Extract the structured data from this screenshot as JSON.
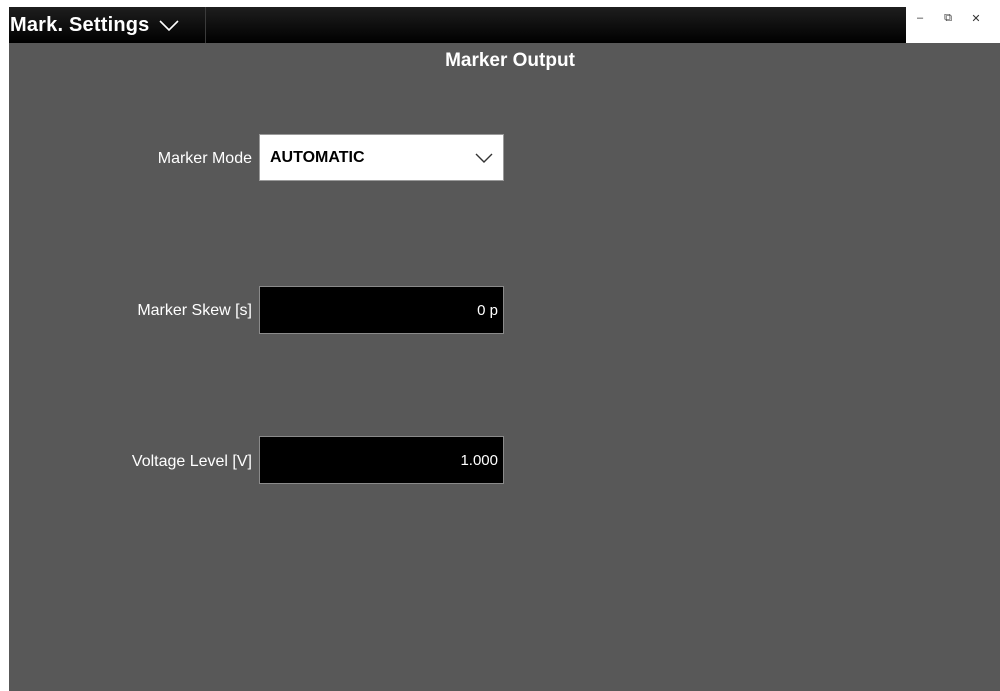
{
  "title_bar": {
    "title": "Mark. Settings",
    "controls": {
      "minimize": "–",
      "restore": "⧉",
      "close": "✕"
    }
  },
  "main": {
    "heading": "Marker Output",
    "marker_mode": {
      "label": "Marker Mode",
      "value": "AUTOMATIC"
    },
    "marker_skew": {
      "label": "Marker Skew [s]",
      "value": "0 p"
    },
    "voltage_level": {
      "label": "Voltage Level [V]",
      "value": "1.000"
    }
  },
  "colors": {
    "background": "#585858",
    "title_bar": "#000000",
    "field": "#000000",
    "select": "#ffffff"
  }
}
